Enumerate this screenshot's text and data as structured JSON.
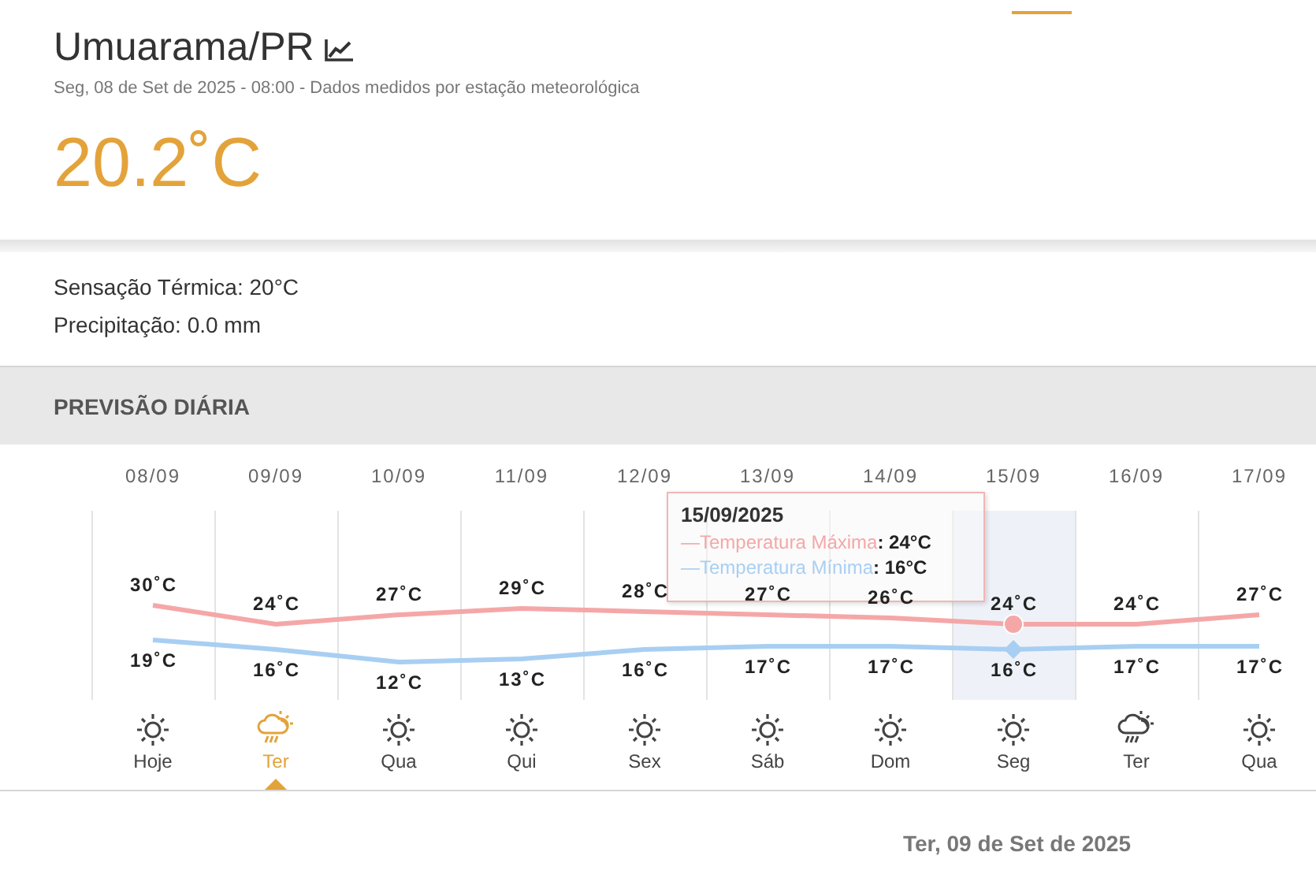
{
  "location": {
    "title": "Umuarama/PR",
    "subtitle": "Seg, 08 de Set de 2025 - 08:00 - Dados medidos por estação meteorológica",
    "temperature": "20.2˚C"
  },
  "details": [
    "Sensação Térmica: 20°C",
    "Precipitação: 0.0 mm"
  ],
  "forecast": {
    "heading": "PREVISÃO DIÁRIA",
    "days": [
      {
        "date": "08/09",
        "day": "Hoje",
        "max": "30˚C",
        "min": "19˚C",
        "kind": "sunny",
        "selected": false,
        "highlighted": false
      },
      {
        "date": "09/09",
        "day": "Ter",
        "max": "24˚C",
        "min": "16˚C",
        "kind": "rain",
        "selected": true,
        "highlighted": false
      },
      {
        "date": "10/09",
        "day": "Qua",
        "max": "27˚C",
        "min": "12˚C",
        "kind": "sunny",
        "selected": false,
        "highlighted": false
      },
      {
        "date": "11/09",
        "day": "Qui",
        "max": "29˚C",
        "min": "13˚C",
        "kind": "sunny",
        "selected": false,
        "highlighted": false
      },
      {
        "date": "12/09",
        "day": "Sex",
        "max": "28˚C",
        "min": "16˚C",
        "kind": "sunny",
        "selected": false,
        "highlighted": false
      },
      {
        "date": "13/09",
        "day": "Sáb",
        "max": "27˚C",
        "min": "17˚C",
        "kind": "sunny",
        "selected": false,
        "highlighted": false
      },
      {
        "date": "14/09",
        "day": "Dom",
        "max": "26˚C",
        "min": "17˚C",
        "kind": "sunny",
        "selected": false,
        "highlighted": false
      },
      {
        "date": "15/09",
        "day": "Seg",
        "max": "24˚C",
        "min": "16˚C",
        "kind": "sunny",
        "selected": false,
        "highlighted": true
      },
      {
        "date": "16/09",
        "day": "Ter",
        "max": "24˚C",
        "min": "17˚C",
        "kind": "rain",
        "selected": false,
        "highlighted": false
      },
      {
        "date": "17/09",
        "day": "Qua",
        "max": "27˚C",
        "min": "17˚C",
        "kind": "sunny",
        "selected": false,
        "highlighted": false
      }
    ],
    "tooltip": {
      "title": "15/09/2025",
      "entries": [
        {
          "name": "—Temperatura Máxima",
          "value": ": 24°C",
          "color": "#f5a7a7"
        },
        {
          "name": "—Temperatura Mínima",
          "value": ": 16°C",
          "color": "#a8cff2"
        }
      ]
    }
  },
  "selected_date": "Ter, 09 de Set de 2025"
}
